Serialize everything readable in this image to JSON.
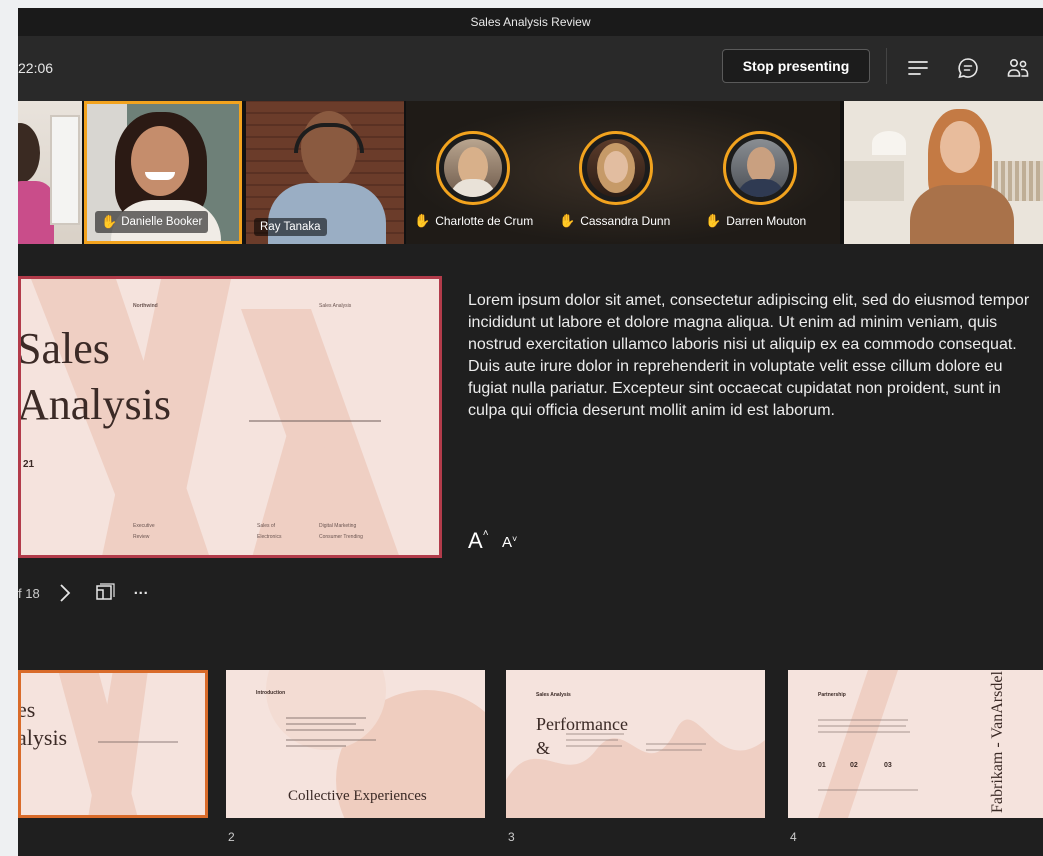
{
  "window": {
    "title": "Sales Analysis Review"
  },
  "toolbar": {
    "timer": "22:06",
    "stop_presenting_label": "Stop presenting",
    "icons": [
      "notes-icon",
      "chat-icon",
      "participants-icon"
    ]
  },
  "participants": [
    {
      "name": "",
      "type": "video",
      "raised_hand": false
    },
    {
      "name": "Danielle Booker",
      "type": "video",
      "raised_hand": true,
      "active_speaker": true
    },
    {
      "name": "Ray Tanaka",
      "type": "video",
      "raised_hand": false
    },
    {
      "name": "Charlotte de Crum",
      "type": "avatar",
      "raised_hand": true
    },
    {
      "name": "Cassandra Dunn",
      "type": "avatar",
      "raised_hand": true
    },
    {
      "name": "Darren Mouton",
      "type": "avatar",
      "raised_hand": true
    },
    {
      "name": "",
      "type": "video",
      "raised_hand": false
    }
  ],
  "current_slide": {
    "title_line1": "Sales",
    "title_line2": "Analysis",
    "year_fragment": "21",
    "header_left": "Northwind",
    "header_right": "Sales Analysis",
    "footer": [
      "Executive",
      "Review",
      "Sales of",
      "Electronics",
      "Digital Marketing",
      "Consumer Trending"
    ]
  },
  "notes": {
    "text": "Lorem ipsum dolor sit amet, consectetur adipiscing elit, sed do eiusmod tempor incididunt ut labore et dolore magna aliqua. Ut enim ad minim veniam, quis nostrud exercitation ullamco laboris nisi ut aliquip ex ea commodo consequat. Duis aute irure dolor in reprehenderit in voluptate velit esse cillum dolore eu fugiat nulla pariatur. Excepteur sint occaecat cupidatat non proident, sunt in culpa qui officia deserunt mollit anim id est laborum.",
    "increase_font_label": "A",
    "decrease_font_label": "A"
  },
  "slide_nav": {
    "counter": "f 18",
    "more_label": "···"
  },
  "thumbnails": [
    {
      "number": "",
      "title_a": "es",
      "title_b": "alysis"
    },
    {
      "number": "2",
      "heading": "Introduction",
      "caption": "Collective Experiences"
    },
    {
      "number": "3",
      "heading": "Sales Analysis",
      "title_a": "Performance",
      "title_b": "&"
    },
    {
      "number": "4",
      "heading": "Partnership",
      "side_text": "Fabrikam - VanArsdel",
      "stats": [
        "01",
        "02",
        "03"
      ]
    }
  ],
  "colors": {
    "accent": "#f2a31e",
    "active_slide_border": "#b23b4a",
    "slide_bg": "#f5e3dd",
    "app_bg": "#1f1f1f"
  }
}
